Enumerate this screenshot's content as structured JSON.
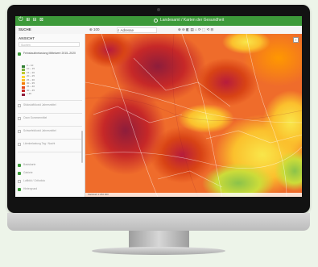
{
  "titlebar": {
    "icons": "⏻ ⊞ ⊟ ⊠",
    "title": "Landesamt / Karten der Gesundheit"
  },
  "toolbar": {
    "left_label": "SUCHE",
    "zoom_label": "⊕ 100",
    "search_label": "⌕ Adresse",
    "tools": "⊕ ⊖ ◧ ▤ ⌂ ⟳ ⬚ ⟲ ⊟"
  },
  "sidebar": {
    "title": "ANSICHT",
    "search_placeholder": "Suchen",
    "active_layer": "Feinstaubbelastung Mittelwert 2015–2020",
    "legend": [
      {
        "label": "0 – 10",
        "color": "#2e7d32"
      },
      {
        "label": "10 – 15",
        "color": "#7cb342"
      },
      {
        "label": "15 – 20",
        "color": "#c0ca33"
      },
      {
        "label": "20 – 25",
        "color": "#fdd835"
      },
      {
        "label": "25 – 30",
        "color": "#fbc02d"
      },
      {
        "label": "30 – 35",
        "color": "#f57c00"
      },
      {
        "label": "35 – 40",
        "color": "#e64a19"
      },
      {
        "label": "40 – 45",
        "color": "#c62828"
      },
      {
        "label": "> 45",
        "color": "#8e1d3b"
      }
    ],
    "layers": [
      "Stickstoffdioxid Jahresmittel",
      "Ozon Sommermittel",
      "Schwefeldioxid Jahresmittel",
      "Lärmbelastung Tag / Nacht"
    ],
    "bottom_items": [
      "Basiskarte",
      "Gebiete",
      "Luftbild / Orthofoto",
      "Hintergrund"
    ]
  },
  "map": {
    "status_text": "Maßstab 1:250.000",
    "zoom_in": "+"
  },
  "colors": {
    "titlebar": "#3d9a3a",
    "heat_low": "#fdd835",
    "heat_mid": "#f57c00",
    "heat_high": "#c62828",
    "heat_max": "#8e1d3b"
  }
}
